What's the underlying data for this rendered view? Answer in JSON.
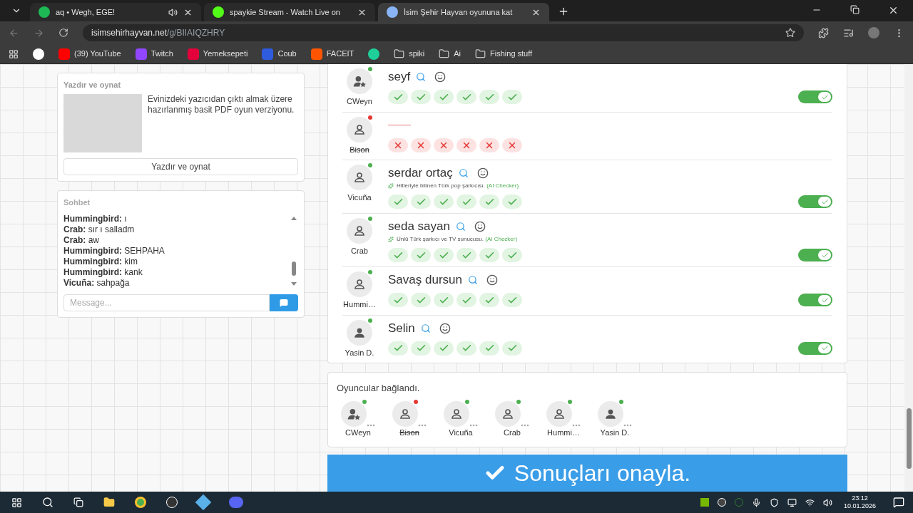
{
  "browser": {
    "tabs": [
      {
        "title": "aq • Wegh, EGE!",
        "kind": "music",
        "audio": true,
        "selected": false
      },
      {
        "title": "spaykie Stream - Watch Live on",
        "kind": "stream",
        "audio": false,
        "selected": false
      },
      {
        "title": "İsim Şehir Hayvan oyununa kat",
        "kind": "game",
        "audio": false,
        "selected": true
      }
    ],
    "url": {
      "host": "isimsehirhayvan.net",
      "path": "/g/BIIAIQZHRY"
    },
    "bookmarks": [
      {
        "kind": "google"
      },
      {
        "label": "(39) YouTube",
        "kind": "youtube"
      },
      {
        "label": "Twitch",
        "kind": "twitch"
      },
      {
        "label": "Yemeksepeti",
        "kind": "yemek"
      },
      {
        "label": "Coub",
        "kind": "coub"
      },
      {
        "label": "FACEIT",
        "kind": "faceit"
      },
      {
        "kind": "shield"
      },
      {
        "label": "spiki",
        "kind": "folder"
      },
      {
        "label": "Ai",
        "kind": "folder"
      },
      {
        "label": "Fishing stuff",
        "kind": "folder"
      }
    ]
  },
  "print_card": {
    "title": "Yazdır ve oynat",
    "description": "Evinizdeki yazıcıdan çıktı almak üzere hazırlanmış basit PDF oyun verziyonu.",
    "button": "Yazdır ve oynat"
  },
  "chat": {
    "title": "Sohbet",
    "placeholder": "Message...",
    "messages": [
      {
        "author": "Hummingbird:",
        "text": "ı"
      },
      {
        "author": "Crab:",
        "text": "sır ı salladm"
      },
      {
        "author": "Crab:",
        "text": "aw"
      },
      {
        "author": "Hummingbird:",
        "text": "SEHPAHA"
      },
      {
        "author": "Hummingbird:",
        "text": "kim"
      },
      {
        "author": "Hummingbird:",
        "text": "kank"
      },
      {
        "author": "Vicuña:",
        "text": "sahpağa"
      }
    ]
  },
  "answers": [
    {
      "player": "CWeyn",
      "kind": "host",
      "color": "#4caf50",
      "left": false,
      "answer": "seyf",
      "marks": [
        true,
        true,
        true,
        true,
        true,
        true
      ],
      "toggle": {
        "on": true
      }
    },
    {
      "player": "Bison",
      "kind": "guest",
      "color": "#e53935",
      "left": true,
      "marks": [
        false,
        false,
        false,
        false,
        false,
        false
      ]
    },
    {
      "player": "Vicuña",
      "kind": "guest",
      "color": "#4caf50",
      "left": false,
      "answer": "serdar ortaç",
      "note": "Hitleriyle bilinen Türk pop şarkıcısı.",
      "note_source": "(AI Checker)",
      "marks": [
        true,
        true,
        true,
        true,
        true,
        true
      ],
      "toggle": {
        "on": true
      }
    },
    {
      "player": "Crab",
      "kind": "guest",
      "color": "#4caf50",
      "left": false,
      "answer": "seda sayan",
      "note": "Ünlü Türk şarkıcı ve TV sunucusu.",
      "note_source": "(AI Checker)",
      "marks": [
        true,
        true,
        true,
        true,
        true,
        true
      ],
      "toggle": {
        "on": true
      }
    },
    {
      "player": "Hummi…",
      "kind": "guest",
      "color": "#4caf50",
      "left": false,
      "answer": "Savaş dursun",
      "marks": [
        true,
        true,
        true,
        true,
        true,
        true
      ],
      "toggle": {
        "on": true
      }
    },
    {
      "player": "Yasin D.",
      "kind": "user",
      "color": "#4caf50",
      "left": false,
      "answer": "Selin",
      "marks": [
        true,
        true,
        true,
        true,
        true,
        true
      ],
      "toggle": {
        "on": true
      }
    }
  ],
  "players": {
    "title": "Oyuncular bağlandı.",
    "items": [
      {
        "name": "CWeyn",
        "kind": "host",
        "color": "#4caf50",
        "left": false
      },
      {
        "name": "Bison",
        "kind": "guest",
        "color": "#e53935",
        "left": true
      },
      {
        "name": "Vicuña",
        "kind": "guest",
        "color": "#4caf50",
        "left": false
      },
      {
        "name": "Crab",
        "kind": "guest",
        "color": "#4caf50",
        "left": false
      },
      {
        "name": "Hummi…",
        "kind": "guest",
        "color": "#4caf50",
        "left": false
      },
      {
        "name": "Yasin D.",
        "kind": "user",
        "color": "#4caf50",
        "left": false
      }
    ]
  },
  "confirm_button": "Sonuçları onayla.",
  "taskbar": {
    "time": "23:12",
    "date": "10.01.2026"
  }
}
